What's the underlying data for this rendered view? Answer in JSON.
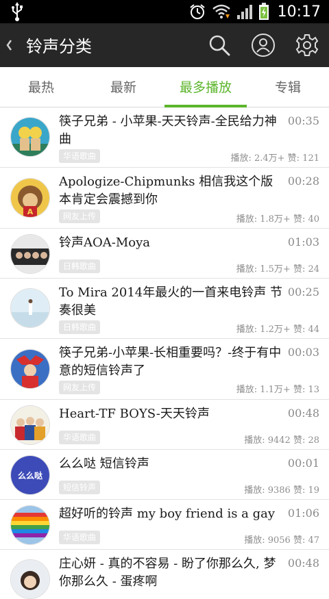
{
  "status_bar": {
    "time": "10:17"
  },
  "app_bar": {
    "title": "铃声分类"
  },
  "tabs": [
    {
      "label": "最热"
    },
    {
      "label": "最新"
    },
    {
      "label": "最多播放",
      "active": true
    },
    {
      "label": "专辑"
    }
  ],
  "colors": {
    "accent": "#5cb52c",
    "appbar": "#272727",
    "statusbar": "#000000"
  },
  "items": [
    {
      "title": "筷子兄弟 - 小苹果-天天铃声-全民给力神曲",
      "duration": "00:35",
      "tag": "华语歌曲",
      "plays": "播放: 2.4万+",
      "likes": "赞: 121"
    },
    {
      "title": "Apologize-Chipmunks 相信我这个版本肯定会震撼到你",
      "duration": "00:28",
      "tag": "网友上传",
      "plays": "播放: 1.8万+",
      "likes": "赞: 40"
    },
    {
      "title": "铃声AOA-Moya",
      "duration": "01:03",
      "tag": "日韩歌曲",
      "plays": "播放: 1.5万+",
      "likes": "赞: 24"
    },
    {
      "title": "To Mira  2014年最火的一首来电铃声 节奏很美",
      "duration": "00:25",
      "tag": "日韩歌曲",
      "plays": "播放: 1.2万+",
      "likes": "赞: 44"
    },
    {
      "title": "筷子兄弟-小苹果-长相重要吗？-终于有中意的短信铃声了",
      "duration": "00:03",
      "tag": "网友上传",
      "plays": "播放: 1.1万+",
      "likes": "赞: 13"
    },
    {
      "title": "Heart-TF BOYS-天天铃声",
      "duration": "00:48",
      "tag": "华语歌曲",
      "plays": "播放: 9442",
      "likes": "赞: 28"
    },
    {
      "title": "么么哒 短信铃声",
      "duration": "00:01",
      "tag": "短信铃声",
      "plays": "播放: 9386",
      "likes": "赞: 19"
    },
    {
      "title": "超好听的铃声 my boy friend is a gay",
      "duration": "01:06",
      "tag": "华语歌曲",
      "plays": "播放: 9056",
      "likes": "赞: 47"
    },
    {
      "title": "庄心妍 - 真的不容易 - 盼了你那么久, 梦你那么久 - 蛋疼啊",
      "duration": "00:48",
      "tag": "",
      "plays": "",
      "likes": ""
    }
  ],
  "avatar_art": {
    "memememe": "么么哒"
  }
}
